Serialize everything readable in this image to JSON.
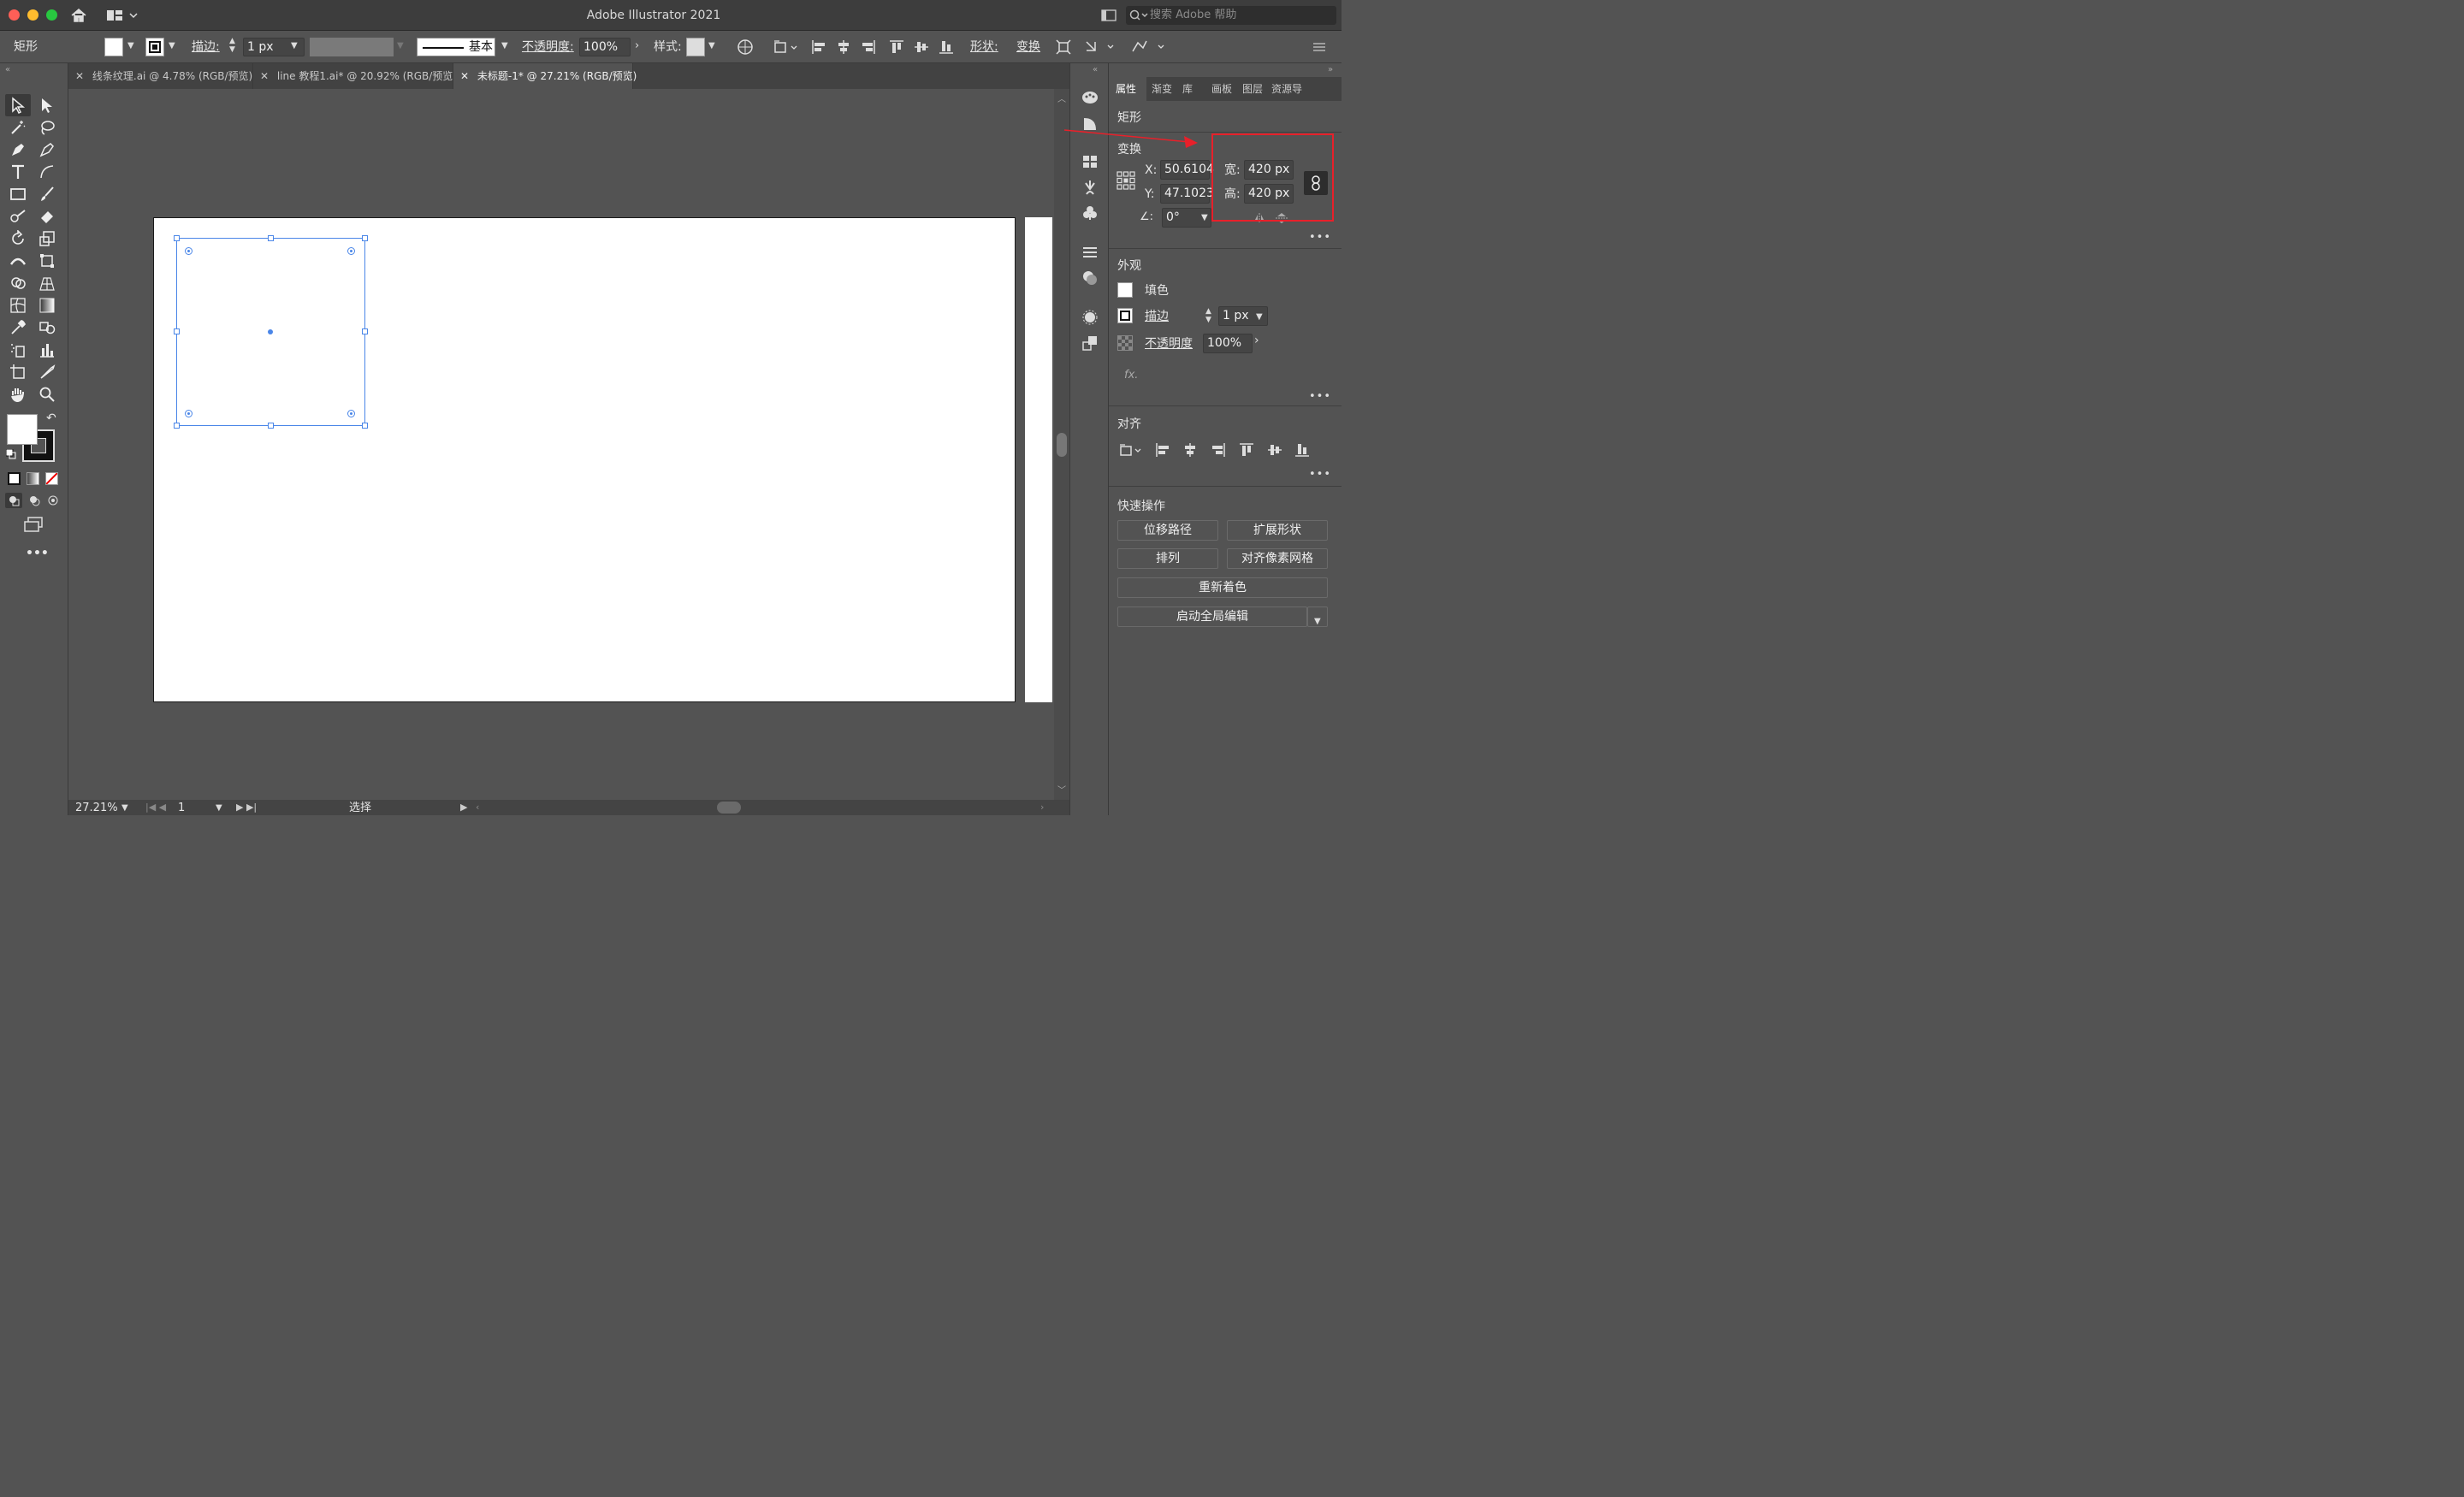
{
  "app": {
    "title": "Adobe Illustrator 2021",
    "search_placeholder": "搜索 Adobe 帮助"
  },
  "control_bar": {
    "object_type": "矩形",
    "stroke_label": "描边:",
    "stroke_value": "1 px",
    "brush_label": "基本",
    "opacity_label": "不透明度:",
    "opacity_value": "100%",
    "style_label": "样式:",
    "shape_label": "形状:",
    "transform_label": "变换"
  },
  "tabs": [
    {
      "label": "线条纹理.ai @ 4.78% (RGB/预览)"
    },
    {
      "label": "line 教程1.ai* @ 20.92% (RGB/预览)"
    },
    {
      "label": "未标题-1* @ 27.21% (RGB/预览)"
    }
  ],
  "status_bar": {
    "zoom": "27.21%",
    "artboard": "1",
    "tool": "选择"
  },
  "panel": {
    "tabs": [
      "属性",
      "渐变",
      "库",
      "画板",
      "图层",
      "资源导"
    ],
    "object_type": "矩形",
    "transform": {
      "title": "变换",
      "x_label": "X:",
      "x_value": "50.6104",
      "y_label": "Y:",
      "y_value": "47.1023",
      "w_label": "宽:",
      "w_value": "420 px",
      "h_label": "高:",
      "h_value": "420 px",
      "angle_value": "0°"
    },
    "appearance": {
      "title": "外观",
      "fill_label": "填色",
      "stroke_label": "描边",
      "stroke_value": "1 px",
      "opacity_label": "不透明度",
      "opacity_value": "100%",
      "fx_label": "fx."
    },
    "align": {
      "title": "对齐"
    },
    "quick_actions": {
      "title": "快速操作",
      "offset_path": "位移路径",
      "expand_shape": "扩展形状",
      "arrange": "排列",
      "align_pixel": "对齐像素网格",
      "recolor": "重新着色",
      "global_edit": "启动全局编辑"
    }
  },
  "colors": {
    "highlight": "#e8202a",
    "selection": "#4a86e8"
  }
}
